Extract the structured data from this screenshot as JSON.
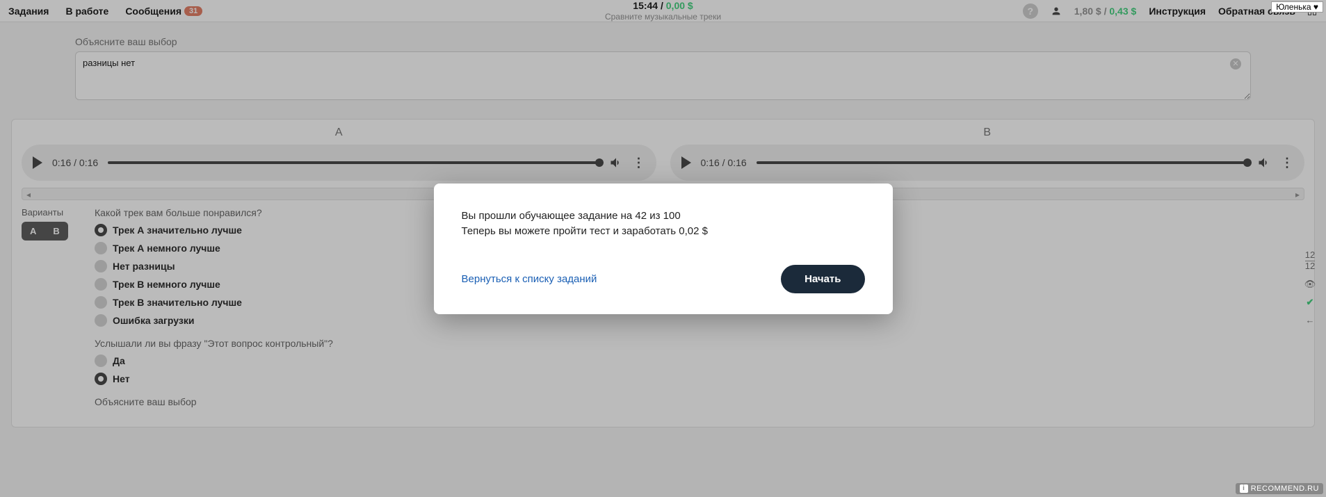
{
  "header": {
    "nav": {
      "tasks": "Задания",
      "in_work": "В работе",
      "messages": "Сообщения",
      "messages_badge": "31"
    },
    "center": {
      "time": "15:44",
      "sep": " / ",
      "amount": "0,00 $",
      "subtitle": "Сравните музыкальные треки"
    },
    "right": {
      "balance_gray": "1,80 $",
      "balance_sep": " / ",
      "balance_green": "0,43 $",
      "instruction": "Инструкция",
      "feedback": "Обратная связь"
    },
    "username": "Юленька ♥"
  },
  "explain": {
    "label": "Объясните ваш выбор",
    "value": "разницы нет"
  },
  "tracks": {
    "a": {
      "title": "A",
      "time": "0:16 / 0:16"
    },
    "b": {
      "title": "B",
      "time": "0:16 / 0:16"
    }
  },
  "variants": {
    "label": "Варианты",
    "a": "A",
    "b": "B"
  },
  "q1": {
    "label": "Какой трек вам больше понравился?",
    "options": [
      "Трек А значительно лучше",
      "Трек А немного лучше",
      "Нет разницы",
      "Трек В немного лучше",
      "Трек В значительно лучше",
      "Ошибка загрузки"
    ],
    "selected": 0
  },
  "q2": {
    "label": "Услышали ли вы фразу \"Этот вопрос контрольный\"?",
    "options": [
      "Да",
      "Нет"
    ],
    "selected": 1
  },
  "explain2_label": "Объясните ваш выбор",
  "gutter": {
    "num": "12",
    "den": "12"
  },
  "modal": {
    "line1": "Вы прошли обучающее задание на 42 из 100",
    "line2": "Теперь вы можете пройти тест и заработать 0,02 $",
    "back": "Вернуться к списку заданий",
    "start": "Начать"
  },
  "watermark": "RECOMMEND.RU"
}
